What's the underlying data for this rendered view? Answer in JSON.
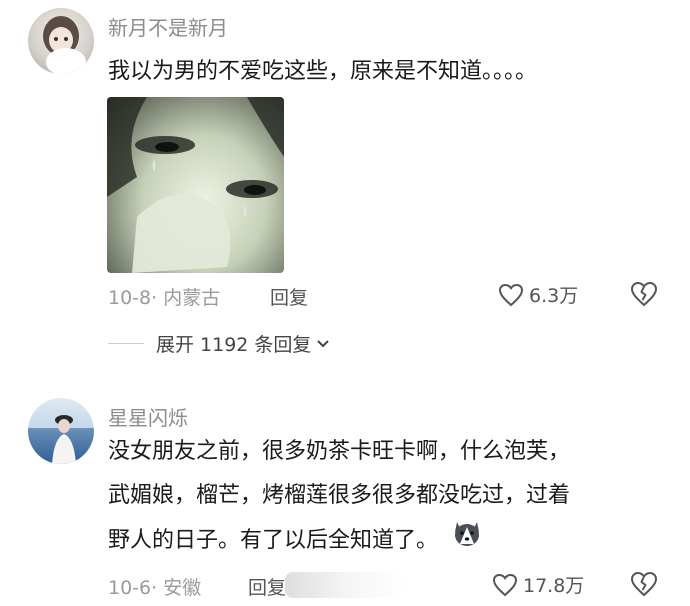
{
  "comments": [
    {
      "username": "新月不是新月",
      "text": "我以为男的不爱吃这些，原来是不知道。。。。",
      "date_location": "10-8· 内蒙古",
      "reply_label": "回复",
      "likes": "6.3万",
      "replies_toggle": "展开 1192 条回复"
    },
    {
      "username": "星星闪烁",
      "text_lines": [
        "没女朋友之前，很多奶茶卡旺卡啊，什么泡芙，",
        "武媚娘，榴芒，烤榴莲很多很多都没吃过，过着",
        "野人的日子。有了以后全知道了。"
      ],
      "date_location": "10-6· 安徽",
      "reply_label": "回复",
      "likes": "17.8万"
    }
  ],
  "icons": {
    "like": "heart-outline-icon",
    "dislike": "broken-heart-icon",
    "expand": "chevron-down-icon",
    "emoji": "husky-dog-emoji"
  }
}
